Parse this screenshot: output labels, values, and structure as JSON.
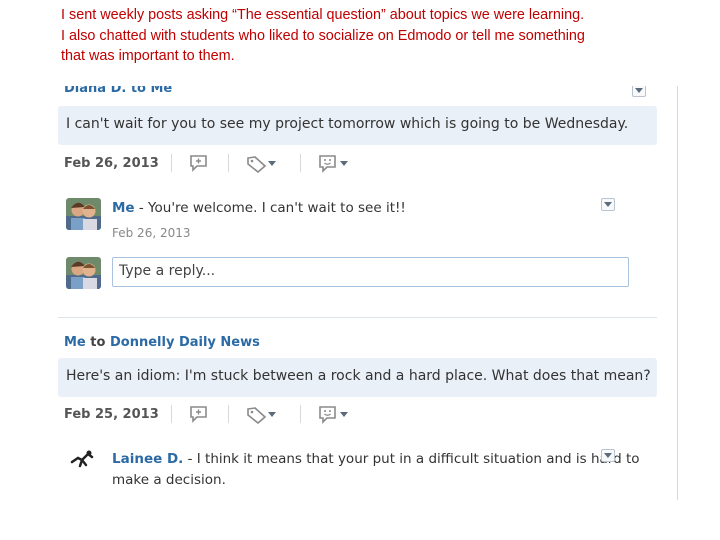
{
  "caption": {
    "line1": "I sent weekly posts asking “The essential question” about topics we were learning.",
    "line2": "I also chatted with students who liked to socialize on Edmodo or tell me something",
    "line3": "that was important to them."
  },
  "post1": {
    "header": "Diana D. to Me",
    "message": "I can't wait for you to see my project tomorrow which is going to be Wednesday.",
    "date": "Feb 26, 2013",
    "reply": {
      "author": "Me",
      "text": " - You're welcome. I can't wait to see it!!",
      "date": "Feb 26, 2013"
    },
    "reply_placeholder": "Type a reply..."
  },
  "post2": {
    "sender": "Me",
    "to": "to",
    "recipient": "Donnelly Daily News",
    "message": "Here's an idiom: I'm stuck between a rock and a hard place. What does that mean?",
    "date": "Feb 25, 2013",
    "reply": {
      "author": "Lainee D.",
      "text_line1": " - I think it means that your put in a difficult situation and is hard to",
      "text_line2": "make a decision."
    }
  },
  "icons": {
    "reply": "reply-bubble-icon",
    "tag": "tag-icon",
    "reaction": "smiley-bubble-icon",
    "dropdown": "chevron-down-icon"
  },
  "colors": {
    "caption": "#c00000",
    "link": "#2b6aa5",
    "bubble": "#eaf0f7",
    "input_border": "#a9c3df"
  }
}
